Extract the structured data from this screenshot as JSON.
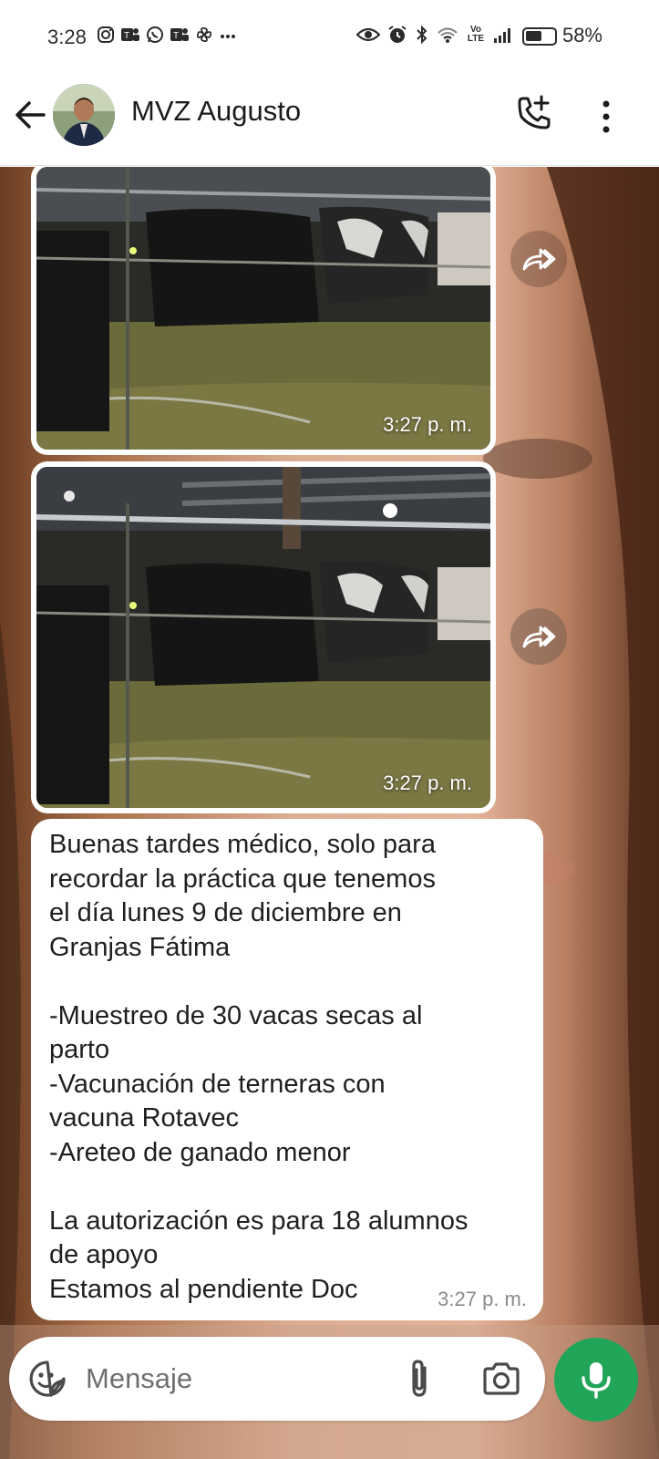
{
  "status_bar": {
    "time": "3:28",
    "battery_percent": "58%",
    "battery_level": 0.58,
    "left_icons": [
      "instagram-icon",
      "teams-icon",
      "whatsapp-icon",
      "teams-icon",
      "pinwheel-icon",
      "more-dots-icon"
    ],
    "right_icons": [
      "eye-icon",
      "alarm-icon",
      "bluetooth-icon",
      "wifi-icon",
      "volte-icon",
      "signal-icon"
    ],
    "volte_label": "Vo LTE"
  },
  "header": {
    "contact_name": "MVZ Augusto",
    "back_icon": "arrow-left-icon",
    "call_icon": "add-call-icon",
    "menu_icon": "more-vert-icon"
  },
  "messages": [
    {
      "type": "image",
      "time": "3:27 p. m.",
      "forward_icon": "forward-icon"
    },
    {
      "type": "image",
      "time": "3:27 p. m.",
      "forward_icon": "forward-icon"
    },
    {
      "type": "text",
      "time": "3:27 p. m.",
      "lines": [
        "Buenas tardes médico, solo para",
        "recordar la práctica que tenemos",
        "el día lunes 9 de diciembre en",
        "Granjas Fátima",
        "",
        "-Muestreo de 30 vacas secas al",
        "parto",
        "-Vacunación de terneras con",
        "vacuna Rotavec",
        "-Areteo de ganado menor",
        "",
        "La autorización es para 18 alumnos",
        "de apoyo",
        "Estamos al pendiente Doc"
      ]
    }
  ],
  "composer": {
    "placeholder": "Mensaje",
    "emoji_icon": "sticker-icon",
    "attach_icon": "paperclip-icon",
    "camera_icon": "camera-icon",
    "mic_icon": "mic-icon"
  },
  "colors": {
    "accent_green": "#21a559",
    "bubble_white": "#ffffff",
    "text_dark": "#1f1f1f",
    "timestamp_gray": "#8a8a8a"
  }
}
